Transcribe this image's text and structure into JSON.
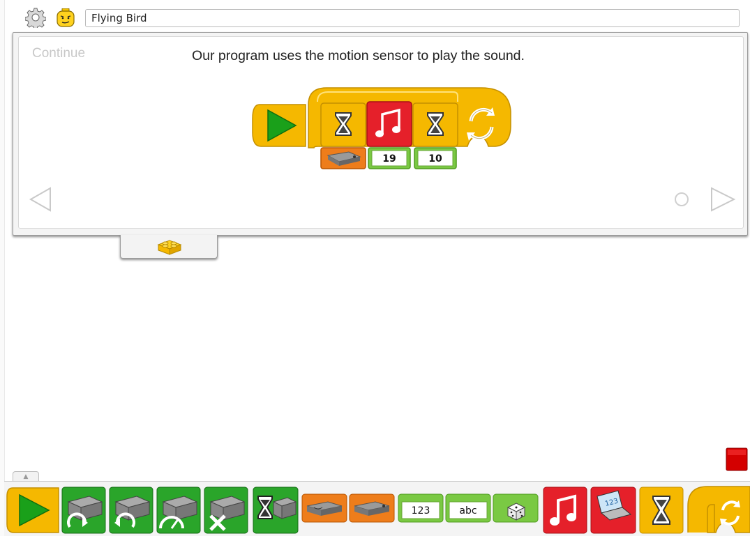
{
  "header": {
    "project_title": "Flying Bird",
    "settings_icon": "gear-icon",
    "profile_icon": "minifig-face-icon"
  },
  "content": {
    "continue_label": "Continue",
    "lesson_text": "Our program uses the motion sensor to play the sound.",
    "program": {
      "blocks": [
        "start",
        "loop",
        "wait-for",
        "sound",
        "wait-for",
        "loop-end"
      ],
      "sound_input": "19",
      "wait_input": "10",
      "sensor_input": "motion-sensor"
    }
  },
  "nav": {
    "prev_icon": "triangle-left-icon",
    "next_icon": "triangle-right-icon",
    "page_indicator_icon": "circle-icon"
  },
  "palette": {
    "toggle_label": "▲",
    "number_label": "123",
    "text_label": "abc",
    "blocks": [
      "start",
      "motor-this-way",
      "motor-that-way",
      "motor-power",
      "motor-off",
      "motor-on-for",
      "tilt-sensor-input",
      "motion-sensor-input",
      "number-input",
      "text-input",
      "random-input",
      "sound",
      "display",
      "wait-for",
      "loop"
    ]
  },
  "colors": {
    "start_green": "#1aa01a",
    "yellow": "#f5b800",
    "red": "#e5202a",
    "motor_green": "#2aa52a",
    "sensor_orange": "#ee7d1b",
    "input_green": "#7ac943",
    "stop_red": "#d40000"
  }
}
